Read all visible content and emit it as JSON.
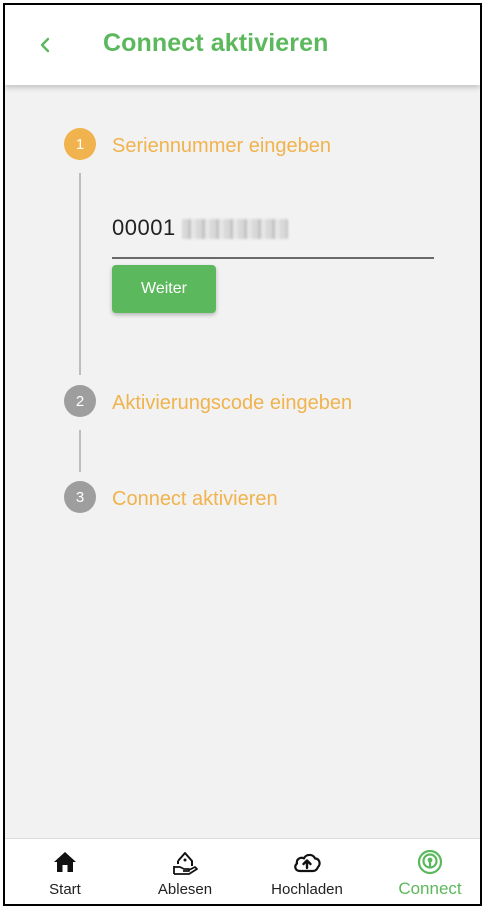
{
  "header": {
    "title": "Connect aktivieren",
    "back_icon": "chevron-left-icon"
  },
  "colors": {
    "brand_green": "#5cb85c",
    "step_active": "#f0b34d",
    "step_inactive": "#9e9e9e"
  },
  "stepper": {
    "steps": [
      {
        "number": "1",
        "label": "Seriennummer eingeben",
        "state": "active"
      },
      {
        "number": "2",
        "label": "Aktivierungscode eingeben",
        "state": "inactive"
      },
      {
        "number": "3",
        "label": "Connect aktivieren",
        "state": "inactive"
      }
    ],
    "serial_input": {
      "value": "00001"
    },
    "next_button": "Weiter"
  },
  "bottom_nav": {
    "items": [
      {
        "label": "Start",
        "icon": "home-icon",
        "active": false
      },
      {
        "label": "Ablesen",
        "icon": "meter-reading-icon",
        "active": false
      },
      {
        "label": "Hochladen",
        "icon": "cloud-upload-icon",
        "active": false
      },
      {
        "label": "Connect",
        "icon": "connect-signal-icon",
        "active": true
      }
    ]
  }
}
